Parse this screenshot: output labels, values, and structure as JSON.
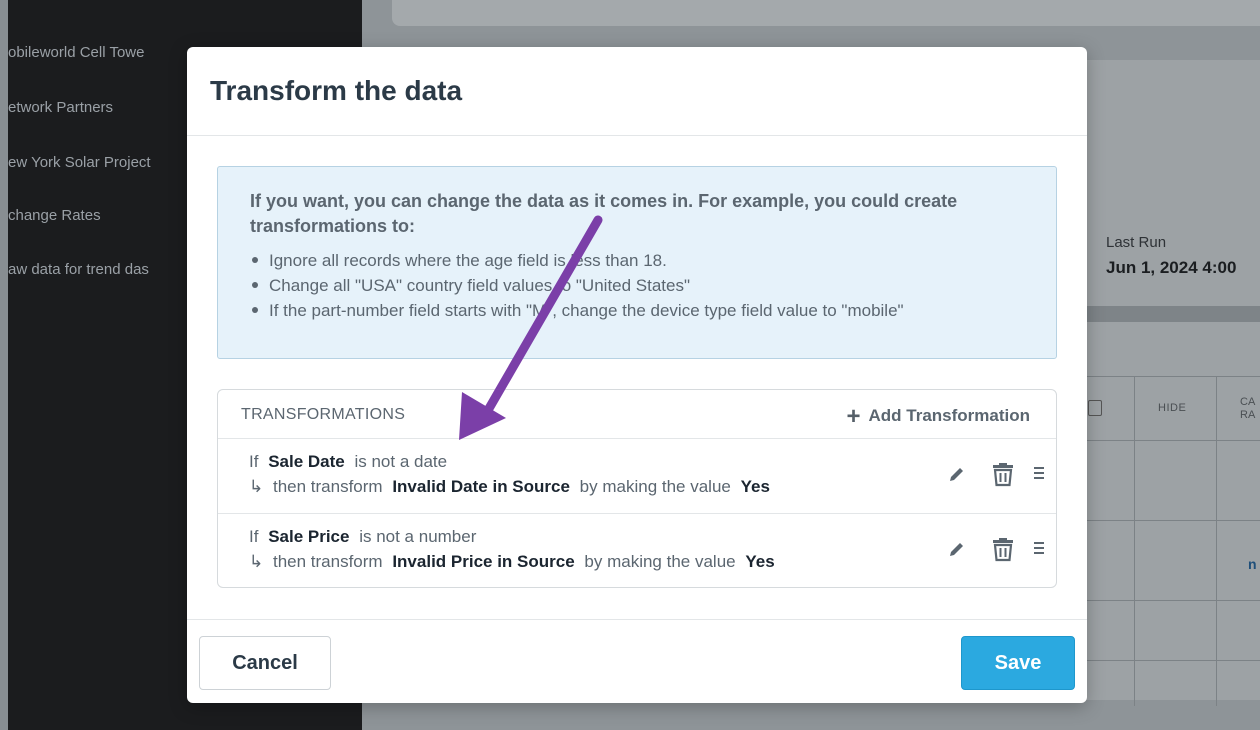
{
  "background": {
    "sidebar_items": [
      {
        "label": "obileworld Cell Towe"
      },
      {
        "label": "etwork Partners"
      },
      {
        "label": "ew York Solar Project"
      },
      {
        "label": "change Rates"
      },
      {
        "label": "aw data for trend das"
      }
    ],
    "last_run_label": "Last Run",
    "last_run_value": "Jun 1, 2024 4:00",
    "column_hide": "HIDE",
    "column_ca": "CA",
    "column_ra": "RA",
    "link_fragment": "n"
  },
  "modal": {
    "title": "Transform the data",
    "info": {
      "intro": "If you want, you can change the data as it comes in. For example, you could create transformations to:",
      "examples": [
        "Ignore all records where the age field is less than 18.",
        "Change all \"USA\" country field values to \"United States\"",
        "If the part-number field starts with \"M\", change the device type field value to \"mobile\""
      ]
    },
    "transformations": {
      "heading": "TRANSFORMATIONS",
      "add_label": "Add Transformation",
      "rows": [
        {
          "if_word": "If",
          "field": "Sale Date",
          "condition": "is not a date",
          "then_text": "then transform",
          "target": "Invalid Date in Source",
          "by_text": "by making the value",
          "value": "Yes"
        },
        {
          "if_word": "If",
          "field": "Sale Price",
          "condition": "is not a number",
          "then_text": "then transform",
          "target": "Invalid Price in Source",
          "by_text": "by making the value",
          "value": "Yes"
        }
      ]
    },
    "footer": {
      "cancel_label": "Cancel",
      "save_label": "Save"
    }
  },
  "colors": {
    "accent": "#2ba9e0",
    "annotation_arrow": "#7b3fa8",
    "info_bg": "#e6f2fa"
  },
  "icons": {
    "add": "plus-icon",
    "edit": "pencil-icon",
    "delete": "trash-icon",
    "reorder": "drag-handle-icon",
    "then": "return-arrow-icon"
  }
}
